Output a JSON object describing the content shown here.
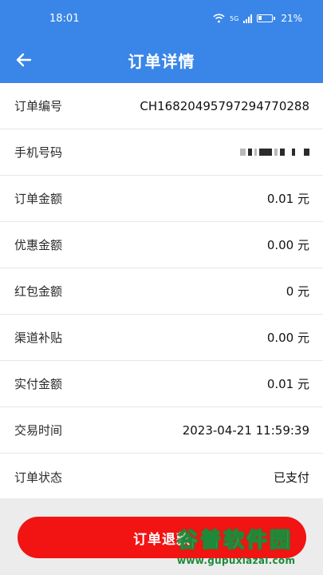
{
  "status_bar": {
    "time": "18:01",
    "signal_label": "5G",
    "battery": "21%"
  },
  "nav": {
    "back_icon": "arrow-left-icon",
    "title": "订单详情"
  },
  "details": [
    {
      "label": "订单编号",
      "value": "CH16820495797294770288"
    },
    {
      "label": "手机号码",
      "value": ""
    },
    {
      "label": "订单金额",
      "value": "0.01 元"
    },
    {
      "label": "优惠金额",
      "value": "0.00 元"
    },
    {
      "label": "红包金额",
      "value": "0 元"
    },
    {
      "label": "渠道补贴",
      "value": "0.00 元"
    },
    {
      "label": "实付金额",
      "value": "0.01 元"
    },
    {
      "label": "交易时间",
      "value": "2023-04-21 11:59:39"
    },
    {
      "label": "订单状态",
      "value": "已支付"
    }
  ],
  "footer": {
    "refund_label": "订单退款"
  },
  "watermark": {
    "title": "谷普软件园",
    "url": "www.gupuxiazai.com"
  },
  "colors": {
    "header_bg": "#3a86e8",
    "button_bg": "#f21313",
    "page_bg": "#ececec"
  }
}
